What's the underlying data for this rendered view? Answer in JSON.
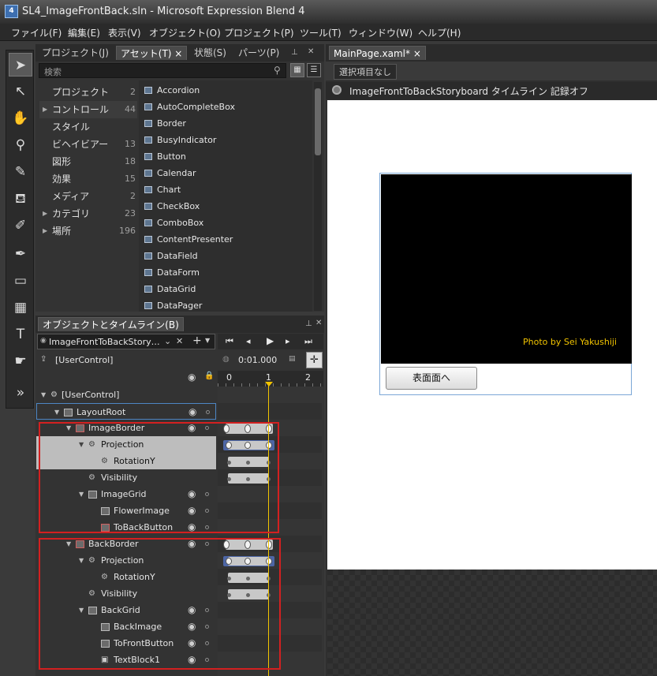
{
  "window": {
    "app_icon": "4",
    "title": "SL4_ImageFrontBack.sln - Microsoft Expression Blend 4"
  },
  "menu": [
    "ファイル(F)",
    "編集(E)",
    "表示(V)",
    "オブジェクト(O)",
    "プロジェクト(P)",
    "ツール(T)",
    "ウィンドウ(W)",
    "ヘルプ(H)"
  ],
  "asset_panel": {
    "tabs": [
      "プロジェクト(J)",
      "アセット(T)",
      "状態(S)",
      "パーツ(P)"
    ],
    "close_glyph": "×",
    "search_placeholder": "検索",
    "categories": [
      {
        "label": "プロジェクト",
        "count": "2"
      },
      {
        "label": "コントロール",
        "count": "44"
      },
      {
        "label": "スタイル",
        "count": ""
      },
      {
        "label": "ビヘイビアー",
        "count": "13"
      },
      {
        "label": "図形",
        "count": "18"
      },
      {
        "label": "効果",
        "count": "15"
      },
      {
        "label": "メディア",
        "count": "2"
      },
      {
        "label": "カテゴリ",
        "count": "23"
      },
      {
        "label": "場所",
        "count": "196"
      }
    ],
    "assets": [
      "Accordion",
      "AutoCompleteBox",
      "Border",
      "BusyIndicator",
      "Button",
      "Calendar",
      "Chart",
      "CheckBox",
      "ComboBox",
      "ContentPresenter",
      "DataField",
      "DataForm",
      "DataGrid",
      "DataPager"
    ]
  },
  "objects_panel": {
    "title": "オブジェクトとタイムライン(B)",
    "storyboard": "ImageFrontToBackStory…",
    "root_label": "[UserControl]",
    "time": "0:01.000",
    "ruler": [
      "0",
      "1",
      "2"
    ],
    "tree": [
      {
        "label": "[UserControl]"
      },
      {
        "label": "LayoutRoot"
      },
      {
        "label": "ImageBorder"
      },
      {
        "label": "Projection"
      },
      {
        "label": "RotationY"
      },
      {
        "label": "Visibility"
      },
      {
        "label": "ImageGrid"
      },
      {
        "label": "FlowerImage"
      },
      {
        "label": "ToBackButton"
      },
      {
        "label": "BackBorder"
      },
      {
        "label": "Projection"
      },
      {
        "label": "RotationY"
      },
      {
        "label": "Visibility"
      },
      {
        "label": "BackGrid"
      },
      {
        "label": "BackImage"
      },
      {
        "label": "ToFrontButton"
      },
      {
        "label": "TextBlock1"
      }
    ]
  },
  "document": {
    "tab": "MainPage.xaml*",
    "breadcrumb": "選択項目なし",
    "recording": "ImageFrontToBackStoryboard タイムライン 記録オフ",
    "photo_credit": "Photo by Sei Yakushiji",
    "button_label": "表面面へ"
  }
}
